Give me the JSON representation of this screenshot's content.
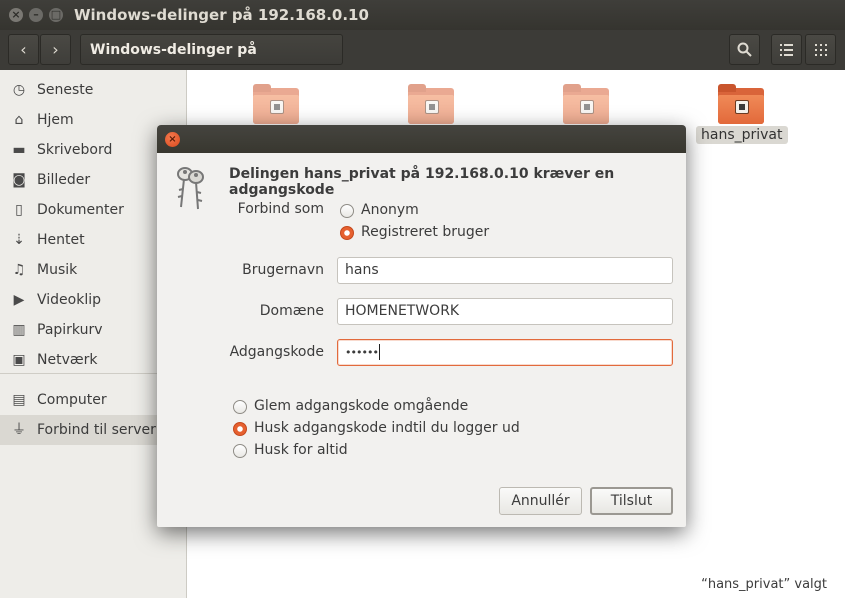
{
  "window": {
    "title": "Windows-delinger på 192.168.0.10"
  },
  "header": {
    "path": "Windows-delinger på 192.168.0.10",
    "back_icon": "chevron-left-icon",
    "forward_icon": "chevron-right-icon",
    "search_icon": "search-icon",
    "list_icon": "list-view-icon",
    "grid_icon": "grid-view-icon"
  },
  "sidebar": {
    "items": [
      {
        "label": "Seneste",
        "icon": "clock-icon"
      },
      {
        "label": "Hjem",
        "icon": "home-icon"
      },
      {
        "label": "Skrivebord",
        "icon": "desktop-folder-icon"
      },
      {
        "label": "Billeder",
        "icon": "camera-icon"
      },
      {
        "label": "Dokumenter",
        "icon": "document-icon"
      },
      {
        "label": "Hentet",
        "icon": "download-icon"
      },
      {
        "label": "Musik",
        "icon": "music-icon"
      },
      {
        "label": "Videoklip",
        "icon": "video-icon"
      },
      {
        "label": "Papirkurv",
        "icon": "trash-icon"
      },
      {
        "label": "Netværk",
        "icon": "network-icon"
      },
      {
        "label": "Computer",
        "icon": "computer-icon"
      },
      {
        "label": "Forbind til server",
        "icon": "server-icon"
      }
    ]
  },
  "content": {
    "selected_folder_label": "hans_privat",
    "status": "“hans_privat” valgt",
    "accent": "#e2693a"
  },
  "dialog": {
    "heading": "Delingen hans_privat på 192.168.0.10 kræver en adgangskode",
    "connect_as_label": "Forbind som",
    "connect_as_options": [
      "Anonym",
      "Registreret bruger"
    ],
    "connect_as_selected": "Registreret bruger",
    "username_label": "Brugernavn",
    "username_value": "hans",
    "domain_label": "Domæne",
    "domain_value": "HOMENETWORK",
    "password_label": "Adgangskode",
    "password_value": "••••••",
    "remember_options": [
      "Glem adgangskode omgående",
      "Husk adgangskode indtil du logger ud",
      "Husk for altid"
    ],
    "remember_selected": "Husk adgangskode indtil du logger ud",
    "cancel_label": "Annullér",
    "connect_label": "Tilslut"
  }
}
